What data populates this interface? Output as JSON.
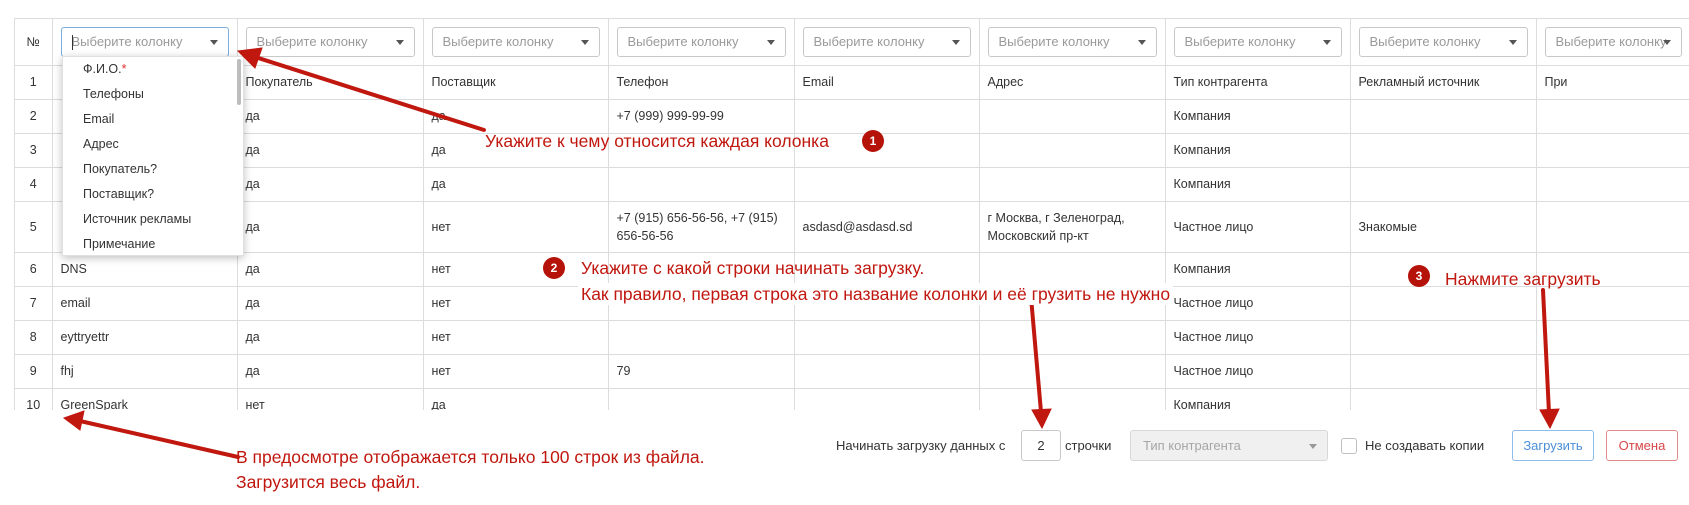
{
  "table": {
    "num_header": "№",
    "select_placeholder": "Выберите колонку",
    "select_count": 9,
    "rows": [
      {
        "num": "1",
        "cells": [
          "",
          "Покупатель",
          "Поставщик",
          "Телефон",
          "Email",
          "Адрес",
          "Тип контрагента",
          "Рекламный источник",
          "При"
        ]
      },
      {
        "num": "2",
        "cells": [
          "",
          "да",
          "да",
          "+7 (999) 999-99-99",
          "",
          "",
          "Компания",
          "",
          ""
        ]
      },
      {
        "num": "3",
        "cells": [
          "",
          "да",
          "да",
          "",
          "",
          "",
          "Компания",
          "",
          ""
        ]
      },
      {
        "num": "4",
        "cells": [
          "",
          "да",
          "да",
          "",
          "",
          "",
          "Компания",
          "",
          ""
        ]
      },
      {
        "num": "5",
        "cells": [
          "",
          "да",
          "нет",
          "+7 (915) 656-56-56, +7 (915) 656-56-56",
          "asdasd@asdasd.sd",
          "г Москва, г Зеленоград, Московский пр-кт",
          "Частное лицо",
          "Знакомые",
          ""
        ]
      },
      {
        "num": "6",
        "cells": [
          "DNS",
          "да",
          "нет",
          "",
          "",
          "",
          "Компания",
          "",
          ""
        ]
      },
      {
        "num": "7",
        "cells": [
          "email",
          "да",
          "нет",
          "",
          "",
          "",
          "Частное лицо",
          "",
          ""
        ]
      },
      {
        "num": "8",
        "cells": [
          "eyttryettr",
          "да",
          "нет",
          "",
          "",
          "",
          "Частное лицо",
          "",
          ""
        ]
      },
      {
        "num": "9",
        "cells": [
          "fhj",
          "да",
          "нет",
          "79",
          "",
          "",
          "Частное лицо",
          "",
          ""
        ]
      },
      {
        "num": "10",
        "cells": [
          "GreenSpark",
          "нет",
          "да",
          "",
          "",
          "",
          "Компания",
          "",
          ""
        ]
      }
    ]
  },
  "dropdown": {
    "options": [
      {
        "label": "Ф.И.О.",
        "required_mark": "*"
      },
      {
        "label": "Телефоны",
        "required_mark": ""
      },
      {
        "label": "Email",
        "required_mark": ""
      },
      {
        "label": "Адрес",
        "required_mark": ""
      },
      {
        "label": "Покупатель?",
        "required_mark": ""
      },
      {
        "label": "Поставщик?",
        "required_mark": ""
      },
      {
        "label": "Источник рекламы",
        "required_mark": ""
      },
      {
        "label": "Примечание",
        "required_mark": ""
      }
    ]
  },
  "footer": {
    "start_label_before": "Начинать загрузку данных с",
    "start_value": "2",
    "start_label_after": "строчки",
    "type_placeholder": "Тип контрагента",
    "no_copy_label": "Не создавать копии",
    "load_button": "Загрузить",
    "cancel_button": "Отмена"
  },
  "annotations": {
    "step1": "Укажите к чему относится каждая колонка",
    "step1_num": "1",
    "step2_line1": "Укажите с какой строки начинать загрузку.",
    "step2_line2": "Как правило, первая строка это название колонки и её грузить не нужно",
    "step2_num": "2",
    "step3": "Нажмите загрузить",
    "step3_num": "3",
    "preview_line1": "В предосмотре отображается только 100 строк из файла.",
    "preview_line2": "Загрузится весь файл."
  },
  "colors": {
    "annotation_red": "#c0170f",
    "badge_red": "#b5120a",
    "load_blue": "#4a8fd8",
    "cancel_red": "#d84848"
  }
}
